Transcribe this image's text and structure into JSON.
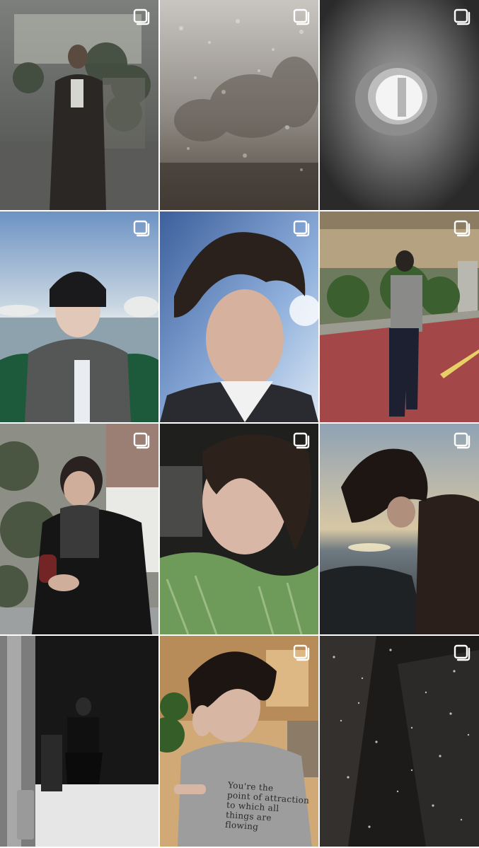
{
  "feed": {
    "layout": "grid",
    "columns": 3,
    "posts": [
      {
        "id": 1,
        "subject": "person in long coat reflected in window",
        "multi_photo": true
      },
      {
        "id": 2,
        "subject": "rain drops on foggy window with trees",
        "multi_photo": true
      },
      {
        "id": 3,
        "subject": "circular tunnel with light at the end",
        "multi_photo": true
      },
      {
        "id": 4,
        "subject": "person in black beanie and grey scarf by lake",
        "multi_photo": true
      },
      {
        "id": 5,
        "subject": "windswept hair selfie against blue sky",
        "multi_photo": true
      },
      {
        "id": 6,
        "subject": "person standing on red path under bridge",
        "multi_photo": true
      },
      {
        "id": 7,
        "subject": "person with wine glass and scarf outdoors",
        "multi_photo": true
      },
      {
        "id": 8,
        "subject": "selfie with hair over face in green shirt",
        "multi_photo": true
      },
      {
        "id": 9,
        "subject": "person looking down at sunset by sea",
        "multi_photo": true
      },
      {
        "id": 10,
        "subject": "dark room with seated figure",
        "multi_photo": false
      },
      {
        "id": 11,
        "subject": "person in grey printed t-shirt touching hair",
        "multi_photo": true
      },
      {
        "id": 12,
        "subject": "dusty dark window glass",
        "multi_photo": true
      }
    ],
    "tshirt_print": "You're the\npoint of attraction\nto which all\nthings are\nflowing"
  },
  "colors": {
    "background": "#ffffff",
    "icon": "#ffffff"
  }
}
